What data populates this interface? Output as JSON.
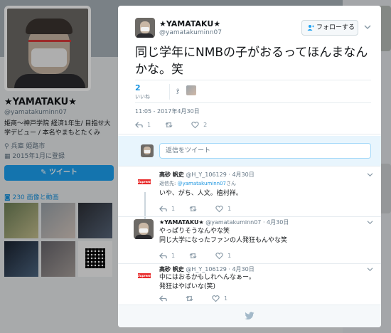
{
  "profile": {
    "name": "★YAMATAKU★",
    "handle": "@yamatakuminn07",
    "bio": "姫商～神戸学院 経済1年生/ 目指せ大学デビュー / 本名やまもとたくみ",
    "location": "兵庫 姫路市",
    "joined": "2015年1月に登録",
    "tweet_button": "ツイート",
    "media_label": "230 画像と動画"
  },
  "tweet": {
    "author_name": "★YAMATAKU★",
    "author_handle": "@yamatakuminn07",
    "follow_label": "フォローする",
    "text": "同じ学年にNMBの子がおるってほんまなんかな。笑",
    "likes_count": "2",
    "likes_label": "いいね",
    "timestamp": "11:05 - 2017年4月30日",
    "reply_count": "1",
    "like_count": "2"
  },
  "reply_box": {
    "placeholder": "返信をツイート"
  },
  "replies": [
    {
      "name": "高砂 帆史",
      "handle": "@H_Y_106129",
      "date": "4月30日",
      "replying_prefix": "返信先:",
      "replying_handle": "@yamatakuminn07",
      "replying_suffix": "さん",
      "lines": [
        "いや、がち、人文。植村祥。"
      ],
      "reply_count": "1",
      "like_count": "1"
    },
    {
      "name": "★YAMATAKU★",
      "handle": "@yamatakuminn07",
      "date": "4月30日",
      "lines": [
        "やっぱりそうなんやな笑",
        "同じ大学になったファンの人発狂もんやな笑"
      ],
      "reply_count": "1",
      "like_count": "1"
    },
    {
      "name": "高砂 帆史",
      "handle": "@H_Y_106129",
      "date": "4月30日",
      "lines": [
        "中にはおるかもしれへんなぁー。",
        "発狂はやばいな(笑)"
      ],
      "reply_count": "",
      "like_count": "1"
    }
  ],
  "avatar_badge": "Supreme",
  "colors": {
    "accent": "#1da1f2",
    "link": "#1b95e0",
    "badge_red": "#e82a2a"
  }
}
